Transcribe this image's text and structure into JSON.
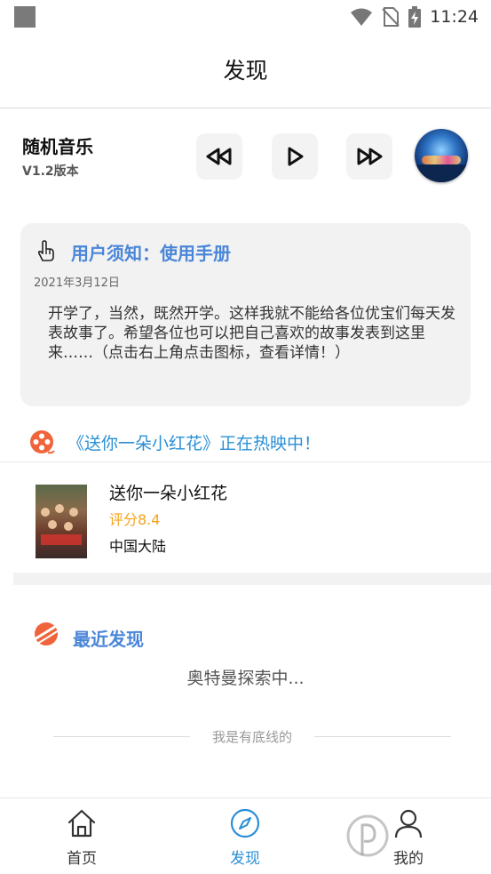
{
  "status_bar": {
    "time": "11:24"
  },
  "header": {
    "title": "发现"
  },
  "player": {
    "name": "随机音乐",
    "version": "V1.2版本",
    "controls": {
      "prev_icon": "rewind-icon",
      "play_icon": "play-icon",
      "next_icon": "fast-forward-icon"
    }
  },
  "notice": {
    "title": "用户须知：使用手册",
    "date": "2021年3月12日",
    "body": "开学了，当然，既然开学。这样我就不能给各位优宝们每天发表故事了。希望各位也可以把自己喜欢的故事发表到这里来……（点击右上角点击图标，查看详情！）",
    "icon": "pointing-hand-icon"
  },
  "hot_movie": {
    "header": "《送你一朵小红花》正在热映中！",
    "icon": "film-reel-icon",
    "name": "送你一朵小红花",
    "rating": "评分8.4",
    "region": "中国大陆"
  },
  "recent": {
    "title": "最近发现",
    "status": "奥特曼探索中...",
    "footer": "我是有底线的"
  },
  "tabs": [
    {
      "label": "首页",
      "icon": "home-icon",
      "active": false
    },
    {
      "label": "发现",
      "icon": "compass-icon",
      "active": true
    },
    {
      "label": "我的",
      "icon": "user-icon",
      "active": false
    }
  ],
  "colors": {
    "accent_blue": "#4a86d8",
    "link_blue": "#2a8fd6",
    "rating_orange": "#f5a21b",
    "icon_orange": "#f0643c"
  }
}
